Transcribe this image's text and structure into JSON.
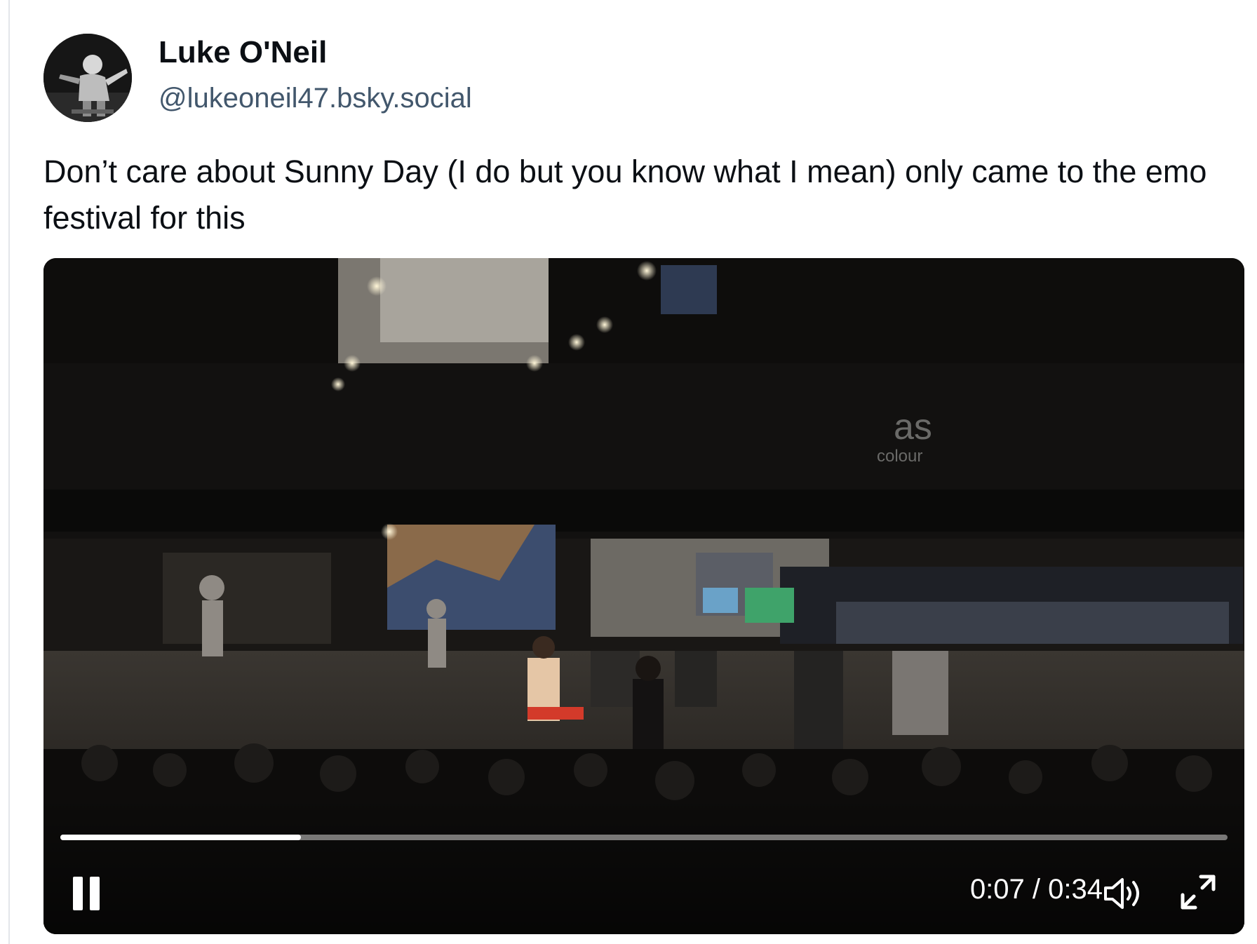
{
  "post": {
    "author": {
      "display_name": "Luke O'Neil",
      "handle": "@lukeoneil47.bsky.social"
    },
    "text": "Don’t care about Sunny Day (I do but you know what I mean) only came to the emo festival for this"
  },
  "video": {
    "current_time": "0:07",
    "duration": "0:34",
    "time_separator": " / ",
    "progress_fraction": 0.206,
    "scene_signage": {
      "logo_mark": "as",
      "logo_word": "colour"
    }
  },
  "icons": {
    "pause": "pause-icon",
    "volume": "speaker-volume-icon",
    "fullscreen": "expand-fullscreen-icon"
  },
  "colors": {
    "text_primary": "#0b0f14",
    "text_secondary": "#42576c",
    "video_bg": "#0b0a09",
    "progress_fill": "#ffffff"
  }
}
